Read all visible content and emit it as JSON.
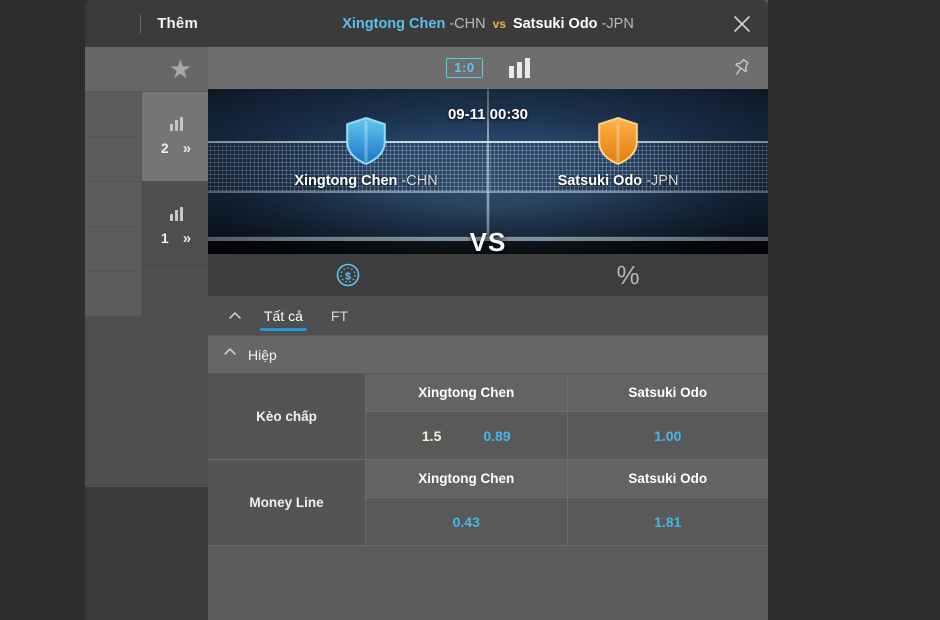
{
  "sidebar": {
    "more_label": "Thêm",
    "star_icon": "star-icon",
    "blocks": [
      {
        "bars_icon": "bar-chart-icon",
        "count": "2",
        "expand_icon": "chevron-double-right-icon",
        "highlight": true
      },
      {
        "bars_icon": "bar-chart-icon",
        "count": "1",
        "expand_icon": "chevron-double-right-icon",
        "highlight": false
      }
    ]
  },
  "title_bar": {
    "team_a": "Xingtong Chen",
    "team_a_suffix": " -CHN",
    "vs": "vs",
    "team_b": "Satsuki Odo",
    "team_b_suffix": " -JPN",
    "close_icon": "close-icon",
    "team_a_color": "#5dc0e8",
    "vs_color": "#e8b646"
  },
  "score_bar": {
    "score": "1:0",
    "score_border_color": "#5ec8ea",
    "stats_icon": "bar-chart-icon",
    "pin_icon": "pin-icon"
  },
  "banner": {
    "date": "09-11 00:30",
    "vs": "VS",
    "left_team": "Xingtong Chen",
    "left_team_suffix": " -CHN",
    "left_shield_icon": "shield-icon-blue",
    "right_team": "Satsuki Odo",
    "right_team_suffix": " -JPN",
    "right_shield_icon": "shield-icon-orange"
  },
  "mode_bar": {
    "money_icon": "dollar-coin-icon",
    "percent_label": "%",
    "money_icon_color": "#5ec8ea"
  },
  "tabs": {
    "collapse_icon": "chevron-up-icon",
    "items": [
      {
        "label": "Tất cả",
        "active": true
      },
      {
        "label": "FT",
        "active": false
      }
    ],
    "active_underline_color": "#2196d8"
  },
  "section": {
    "collapse_icon": "chevron-up-icon",
    "label": "Hiệp"
  },
  "markets": [
    {
      "name": "Kèo chấp",
      "columns": [
        "Xingtong Chen",
        "Satsuki Odo"
      ],
      "cells": [
        {
          "handicap": "1.5",
          "odds": "0.89"
        },
        {
          "handicap": "",
          "odds": "1.00"
        }
      ]
    },
    {
      "name": "Money Line",
      "columns": [
        "Xingtong Chen",
        "Satsuki Odo"
      ],
      "cells": [
        {
          "handicap": "",
          "odds": "0.43"
        },
        {
          "handicap": "",
          "odds": "1.81"
        }
      ]
    }
  ]
}
